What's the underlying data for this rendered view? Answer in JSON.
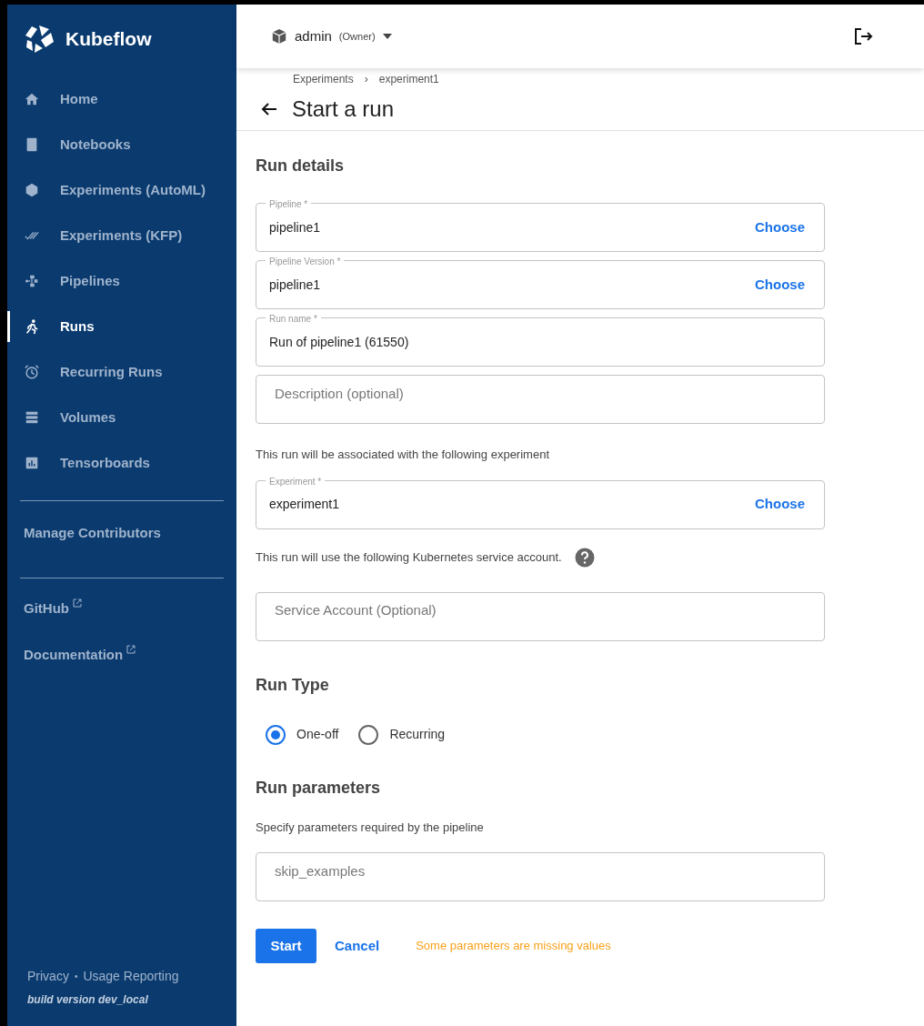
{
  "sidebar": {
    "brand": "Kubeflow",
    "items": [
      {
        "label": "Home",
        "selected": false
      },
      {
        "label": "Notebooks",
        "selected": false
      },
      {
        "label": "Experiments (AutoML)",
        "selected": false
      },
      {
        "label": "Experiments (KFP)",
        "selected": false
      },
      {
        "label": "Pipelines",
        "selected": false
      },
      {
        "label": "Runs",
        "selected": true
      },
      {
        "label": "Recurring Runs",
        "selected": false
      },
      {
        "label": "Volumes",
        "selected": false
      },
      {
        "label": "Tensorboards",
        "selected": false
      }
    ],
    "manage": "Manage Contributors",
    "links": [
      {
        "label": "GitHub"
      },
      {
        "label": "Documentation"
      }
    ],
    "footer": {
      "privacy": "Privacy",
      "separator": "•",
      "usage": "Usage Reporting",
      "build": "build version dev_local"
    }
  },
  "header": {
    "namespace": "admin",
    "role": "(Owner)"
  },
  "breadcrumbs": [
    "Experiments",
    "experiment1"
  ],
  "breadcrumb_separator": "›",
  "title": "Start a run",
  "run_details": {
    "heading": "Run details",
    "fields": [
      {
        "label": "Pipeline *",
        "value": "pipeline1",
        "action": "Choose"
      },
      {
        "label": "Pipeline Version *",
        "value": "pipeline1",
        "action": "Choose"
      },
      {
        "label": "Run name *",
        "value": "Run of pipeline1 (61550)"
      },
      {
        "placeholder": "Description (optional)"
      }
    ],
    "experiment_note": "This run will be associated with the following experiment",
    "experiment_field": {
      "label": "Experiment *",
      "value": "experiment1",
      "action": "Choose"
    },
    "service_note": "This run will use the following Kubernetes service account.",
    "service_field": {
      "placeholder": "Service Account (Optional)"
    }
  },
  "run_type": {
    "heading": "Run Type",
    "options": [
      {
        "label": "One-off",
        "selected": true
      },
      {
        "label": "Recurring",
        "selected": false
      }
    ]
  },
  "run_parameters": {
    "heading": "Run parameters",
    "note": "Specify parameters required by the pipeline",
    "fields": [
      {
        "placeholder": "skip_examples"
      }
    ]
  },
  "actions": {
    "start": "Start",
    "cancel": "Cancel",
    "warning": "Some parameters are missing values"
  }
}
